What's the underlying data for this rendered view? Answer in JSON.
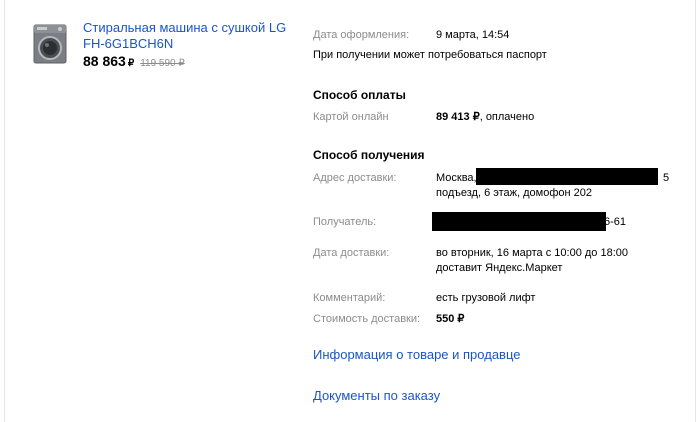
{
  "product": {
    "image_icon": "washing-machine-icon",
    "title": "Стиральная машина с сушкой LG FH-6G1BCH6N",
    "price_current": "88 863",
    "currency": "₽",
    "price_old": "119 590 ₽"
  },
  "order": {
    "date_label": "Дата оформления:",
    "date_value": "9 марта, 14:54",
    "passport_note": "При получении может потребоваться паспорт"
  },
  "payment": {
    "section_title": "Способ оплаты",
    "method_label": "Картой онлайн",
    "amount": "89 413 ₽",
    "status": ", оплачено"
  },
  "delivery": {
    "section_title": "Способ получения",
    "address_label": "Адрес доставки:",
    "address_city": "Москва,",
    "address_tail": "5",
    "address_line2": "подъезд, 6 этаж, домофон 202",
    "recipient_label": "Получатель:",
    "recipient_tail": "6-61",
    "date_label": "Дата доставки:",
    "date_value": "во вторник, 16 марта с 10:00 до 18:00 доставит Яндекс.Маркет",
    "comment_label": "Комментарий:",
    "comment_value": "есть грузовой лифт",
    "cost_label": "Стоимость доставки:",
    "cost_value": "550 ₽"
  },
  "links": {
    "product_info": "Информация о товаре и продавце",
    "documents": "Документы по заказу"
  },
  "colors": {
    "link": "#1a55c8",
    "label": "#8c8c8c",
    "redaction": "#000000"
  }
}
